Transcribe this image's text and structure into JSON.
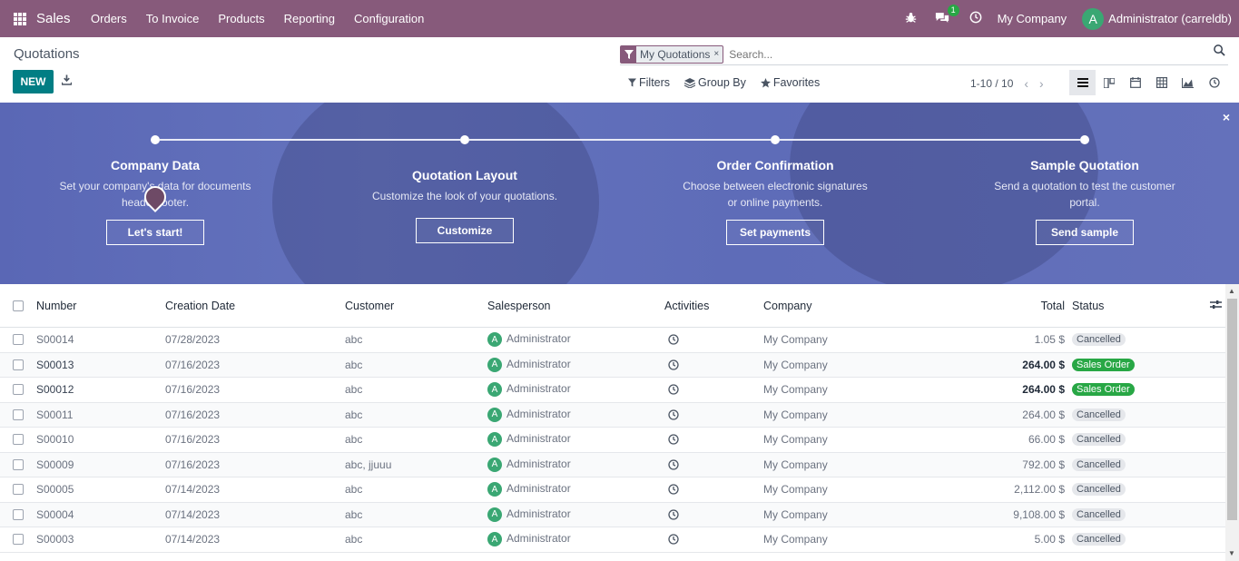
{
  "nav": {
    "app_name": "Sales",
    "menu": [
      "Orders",
      "To Invoice",
      "Products",
      "Reporting",
      "Configuration"
    ],
    "chat_count": "1",
    "company": "My Company",
    "user_initial": "A",
    "user": "Administrator (carreldb)"
  },
  "control": {
    "title": "Quotations",
    "new_label": "NEW",
    "facet_label": "My Quotations",
    "facet_close": "×",
    "search_placeholder": "Search...",
    "filters_label": "Filters",
    "groupby_label": "Group By",
    "favorites_label": "Favorites",
    "pager": "1-10 / 10"
  },
  "banner": {
    "close": "×",
    "steps": [
      {
        "title": "Company Data",
        "desc": "Set your company's data for documents header/footer.",
        "button": "Let's start!"
      },
      {
        "title": "Quotation Layout",
        "desc": "Customize the look of your quotations.",
        "button": "Customize"
      },
      {
        "title": "Order Confirmation",
        "desc": "Choose between electronic signatures or online payments.",
        "button": "Set payments"
      },
      {
        "title": "Sample Quotation",
        "desc": "Send a quotation to test the customer portal.",
        "button": "Send sample"
      }
    ]
  },
  "table": {
    "headers": {
      "number": "Number",
      "date": "Creation Date",
      "customer": "Customer",
      "salesperson": "Salesperson",
      "activities": "Activities",
      "company": "Company",
      "total": "Total",
      "status": "Status"
    },
    "rows": [
      {
        "number": "S00014",
        "date": "07/28/2023",
        "customer": "abc",
        "salesperson": "Administrator",
        "company": "My Company",
        "total": "1.05 $",
        "status": "Cancelled",
        "status_type": "cancelled"
      },
      {
        "number": "S00013",
        "date": "07/16/2023",
        "customer": "abc",
        "salesperson": "Administrator",
        "company": "My Company",
        "total": "264.00 $",
        "status": "Sales Order",
        "status_type": "sales"
      },
      {
        "number": "S00012",
        "date": "07/16/2023",
        "customer": "abc",
        "salesperson": "Administrator",
        "company": "My Company",
        "total": "264.00 $",
        "status": "Sales Order",
        "status_type": "sales"
      },
      {
        "number": "S00011",
        "date": "07/16/2023",
        "customer": "abc",
        "salesperson": "Administrator",
        "company": "My Company",
        "total": "264.00 $",
        "status": "Cancelled",
        "status_type": "cancelled"
      },
      {
        "number": "S00010",
        "date": "07/16/2023",
        "customer": "abc",
        "salesperson": "Administrator",
        "company": "My Company",
        "total": "66.00 $",
        "status": "Cancelled",
        "status_type": "cancelled"
      },
      {
        "number": "S00009",
        "date": "07/16/2023",
        "customer": "abc, jjuuu",
        "salesperson": "Administrator",
        "company": "My Company",
        "total": "792.00 $",
        "status": "Cancelled",
        "status_type": "cancelled"
      },
      {
        "number": "S00005",
        "date": "07/14/2023",
        "customer": "abc",
        "salesperson": "Administrator",
        "company": "My Company",
        "total": "2,112.00 $",
        "status": "Cancelled",
        "status_type": "cancelled"
      },
      {
        "number": "S00004",
        "date": "07/14/2023",
        "customer": "abc",
        "salesperson": "Administrator",
        "company": "My Company",
        "total": "9,108.00 $",
        "status": "Cancelled",
        "status_type": "cancelled"
      },
      {
        "number": "S00003",
        "date": "07/14/2023",
        "customer": "abc",
        "salesperson": "Administrator",
        "company": "My Company",
        "total": "5.00 $",
        "status": "Cancelled",
        "status_type": "cancelled"
      }
    ]
  }
}
